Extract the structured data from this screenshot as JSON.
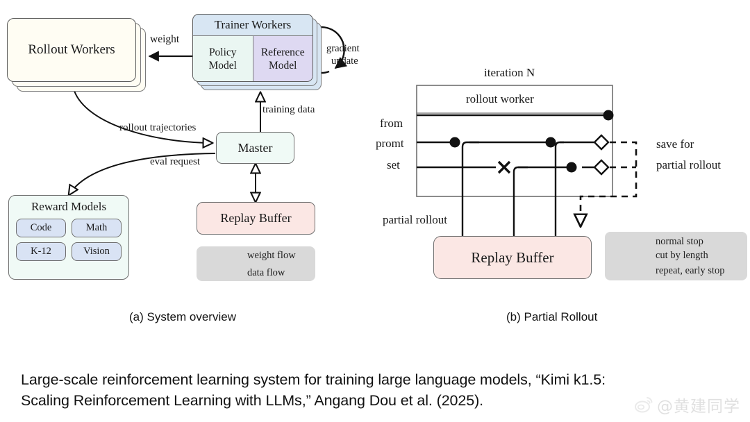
{
  "figure": {
    "panel_a": {
      "caption": "(a) System overview",
      "nodes": {
        "rollout_workers": {
          "label": "Rollout Workers",
          "color": "#fffdf3"
        },
        "trainer_workers": {
          "label": "Trainer Workers",
          "color": "#d8e6f3"
        },
        "policy_model": {
          "label": "Policy\nModel",
          "line1": "Policy",
          "line2": "Model",
          "color": "#eaf6f2"
        },
        "reference_model": {
          "label": "Reference\nModel",
          "line1": "Reference",
          "line2": "Model",
          "color": "#ded9f2"
        },
        "master": {
          "label": "Master",
          "color": "#f0faf6"
        },
        "replay_buffer": {
          "label": "Replay Buffer",
          "color": "#fbe7e4"
        },
        "reward_models": {
          "label": "Reward Models",
          "color": "#f0faf6"
        }
      },
      "reward_children": [
        {
          "label": "Code"
        },
        {
          "label": "Math"
        },
        {
          "label": "K-12"
        },
        {
          "label": "Vision"
        }
      ],
      "reward_child_color": "#d9e3f4",
      "edge_labels": {
        "weight": "weight",
        "gradient_update_line1": "gradient",
        "gradient_update_line2": "update",
        "training_data": "training data",
        "rollout_trajectories": "rollout trajectories",
        "eval_request": "eval request"
      },
      "legend": {
        "box_color": "#d9d9d9",
        "items": [
          {
            "label": "weight flow",
            "marker": "solid-arrow"
          },
          {
            "label": "data flow",
            "marker": "open-arrow"
          }
        ]
      }
    },
    "panel_b": {
      "caption": "(b) Partial Rollout",
      "title": "iteration N",
      "worker_box": {
        "label": "rollout worker",
        "color": "#eaf6f3"
      },
      "replay_buffer": {
        "label": "Replay Buffer",
        "color": "#fbe7e4"
      },
      "side_labels": {
        "from_prompt_set_line1": "from",
        "from_prompt_set_line2": "promt",
        "from_prompt_set_line3": "set",
        "partial_rollout": "partial rollout",
        "save_for_line1": "save for",
        "save_for_line2": "partial rollout"
      },
      "legend": {
        "box_color": "#d9d9d9",
        "items": [
          {
            "label": "normal stop",
            "marker": "filled-circle"
          },
          {
            "label": "cut by length",
            "marker": "open-diamond"
          },
          {
            "label": "repeat, early stop",
            "marker": "cross"
          }
        ]
      }
    }
  },
  "caption": {
    "line1": "Large-scale reinforcement learning system for training large language models, “Kimi k1.5:",
    "line2": "Scaling Reinforcement Learning with LLMs,” Angang Dou et al. (2025)."
  },
  "watermark": {
    "handle": "@黄建同学",
    "icon": "weibo-icon"
  },
  "colors": {
    "stroke": "#1a1a1a",
    "box_border": "#6f6f6f",
    "page_bg": "#ffffff"
  }
}
